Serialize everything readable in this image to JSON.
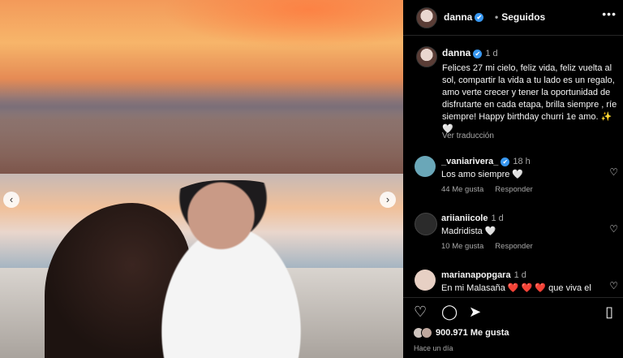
{
  "post": {
    "username": "danna",
    "follow_label": "Seguidos",
    "more_glyph": "•••",
    "verified_glyph": "✔"
  },
  "caption": {
    "username": "danna",
    "time": "1 d",
    "text": "Felices 27 mi cielo, feliz vida, feliz vuelta al sol, compartir la vida a tu lado es un regalo, amo verte crecer y tener la oportunidad de disfrutarte en cada etapa, brilla siempre , ríe siempre! Happy birthday churri 1e amo. ✨ 🤍",
    "translate_label": "Ver traducción"
  },
  "comments": [
    {
      "username": "_vaniarivera_",
      "verified": true,
      "time": "18 h",
      "text": "Los amo siempre 🤍",
      "likes": "44 Me gusta",
      "reply": "Responder",
      "avatar_color": "#6aa7b8"
    },
    {
      "username": "ariianiicole",
      "verified": false,
      "time": "1 d",
      "text": "Madridista 🤍",
      "likes": "10 Me gusta",
      "reply": "Responder",
      "avatar_color": "#2b2b2b"
    },
    {
      "username": "marianapopgara",
      "verified": false,
      "time": "1 d",
      "text": "En mi Malasaña ❤️ ❤️ ❤️ que viva el",
      "likes": "",
      "reply": "",
      "avatar_color": "#e7d0c4"
    }
  ],
  "icons": {
    "heart": "♡",
    "comment": "◯",
    "share": "➤",
    "bookmark": "▯",
    "prev": "‹",
    "next": "›"
  },
  "footer": {
    "likes": "900.971 Me gusta",
    "ago": "Hace un día"
  },
  "colors": {
    "verified": "#3897f0",
    "background": "#000000",
    "muted": "#a8a8a8"
  }
}
